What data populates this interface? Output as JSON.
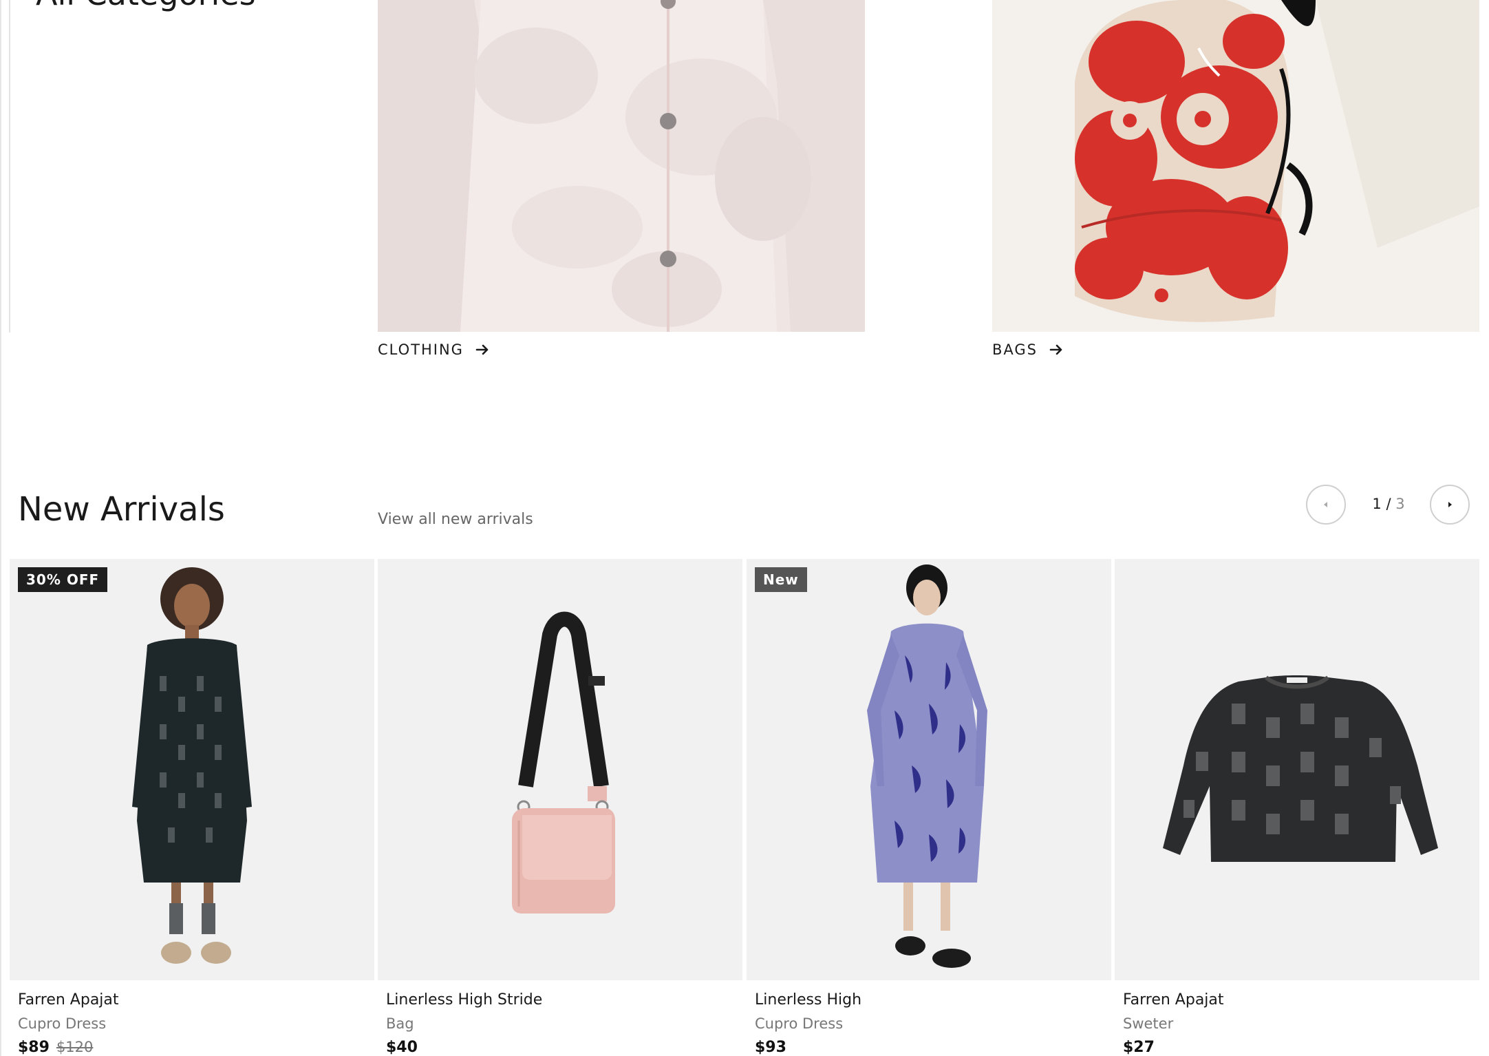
{
  "categories": {
    "title": "All Categories",
    "cards": [
      {
        "label": "CLOTHING"
      },
      {
        "label": "BAGS"
      }
    ]
  },
  "new_arrivals": {
    "title": "New Arrivals",
    "view_all": "View all new arrivals",
    "pager": {
      "current": "1",
      "separator": " / ",
      "total": "3"
    },
    "products": [
      {
        "name": "Farren Apajat",
        "type": "Cupro Dress",
        "price": "$89",
        "old_price": "$120",
        "badge": "30% OFF"
      },
      {
        "name": "Linerless High Stride",
        "type": "Bag",
        "price": "$40"
      },
      {
        "name": "Linerless High",
        "type": "Cupro Dress",
        "price": "$93",
        "badge": "New"
      },
      {
        "name": "Farren Apajat",
        "type": "Sweter",
        "price": "$27"
      }
    ]
  },
  "icons": {
    "arrow": "arrow-right-icon",
    "prev": "chevron-left-icon",
    "next": "chevron-right-icon"
  },
  "colors": {
    "text": "#1a1a1a",
    "muted": "#777777",
    "tile_bg": "#f1f1f1",
    "sale_badge": "#1f1f1f",
    "new_badge": "#555555",
    "backpack_red": "#d7312b"
  }
}
